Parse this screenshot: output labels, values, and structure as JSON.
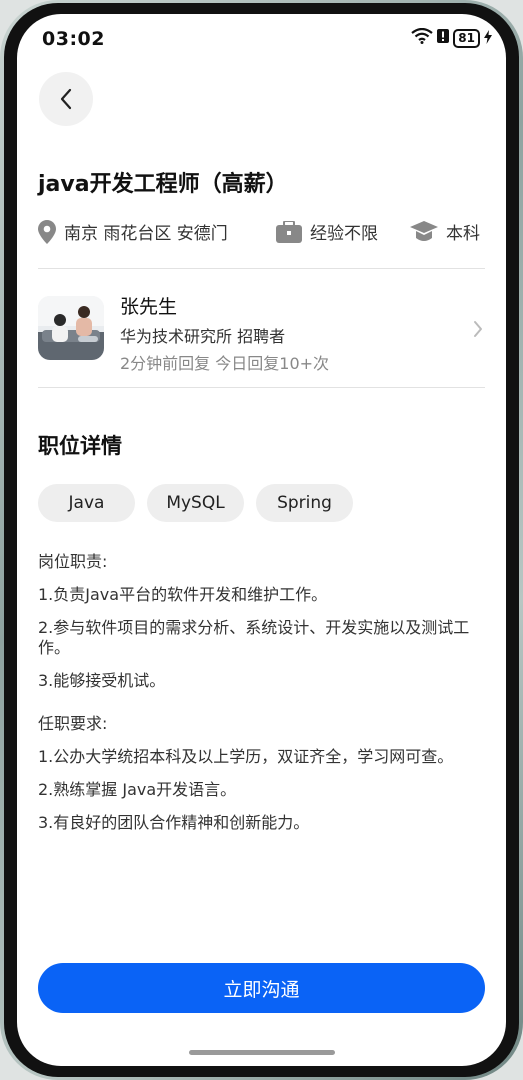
{
  "status_bar": {
    "time": "03:02",
    "battery": "81"
  },
  "job": {
    "title": "java开发工程师（高薪）",
    "location": "南京 雨花台区 安德门",
    "experience": "经验不限",
    "education": "本科"
  },
  "recruiter": {
    "name": "张先生",
    "company_role": "华为技术研究所 招聘者",
    "reply_status": "2分钟前回复 今日回复10+次"
  },
  "details": {
    "section_title": "职位详情",
    "tags": [
      "Java",
      "MySQL",
      "Spring"
    ],
    "duties_heading": "岗位职责:",
    "duties": [
      "1.负责Java平台的软件开发和维护工作。",
      "2.参与软件项目的需求分析、系统设计、开发实施以及测试工作。",
      "3.能够接受机试。"
    ],
    "requirements_heading": "任职要求:",
    "requirements": [
      "1.公办大学统招本科及以上学历，双证齐全，学习网可查。",
      "2.熟练掌握 Java开发语言。",
      "3.有良好的团队合作精神和创新能力。"
    ]
  },
  "cta": {
    "label": "立即沟通",
    "color": "#0a63f6"
  },
  "icons": [
    "back-icon",
    "location-pin-icon",
    "briefcase-icon",
    "graduation-cap-icon",
    "chevron-right-icon",
    "wifi-icon",
    "battery-icon"
  ]
}
